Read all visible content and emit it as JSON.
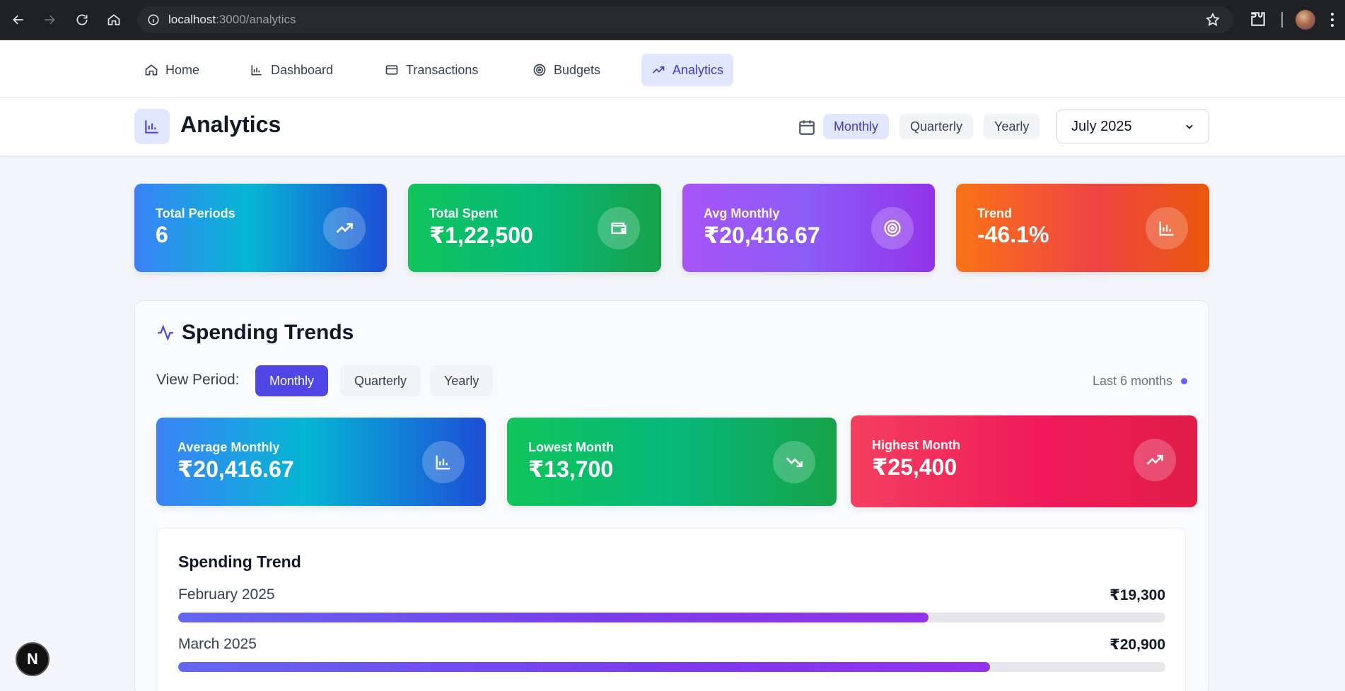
{
  "browser": {
    "url_host": "localhost",
    "url_path": ":3000/analytics"
  },
  "nav": {
    "items": [
      {
        "label": "Home",
        "icon": "home-icon"
      },
      {
        "label": "Dashboard",
        "icon": "bar-chart-icon"
      },
      {
        "label": "Transactions",
        "icon": "credit-card-icon"
      },
      {
        "label": "Budgets",
        "icon": "target-icon"
      },
      {
        "label": "Analytics",
        "icon": "trending-up-icon",
        "active": true
      }
    ]
  },
  "header": {
    "title": "Analytics",
    "period_buttons": [
      "Monthly",
      "Quarterly",
      "Yearly"
    ],
    "active_period": "Monthly",
    "selected_month": "July 2025"
  },
  "stats": [
    {
      "label": "Total Periods",
      "value": "6",
      "icon": "trending-up-icon",
      "gradient": "#3b82f6"
    },
    {
      "label": "Total Spent",
      "value": "₹1,22,500",
      "icon": "wallet-icon",
      "gradient": "#10c55a"
    },
    {
      "label": "Avg Monthly",
      "value": "₹20,416.67",
      "icon": "target-icon",
      "gradient": "#a855f7"
    },
    {
      "label": "Trend",
      "value": "-46.1%",
      "icon": "bar-chart-icon",
      "gradient": "#f97316"
    }
  ],
  "trends": {
    "title": "Spending Trends",
    "view_period_label": "View Period:",
    "view_buttons": [
      "Monthly",
      "Quarterly",
      "Yearly"
    ],
    "active_view": "Monthly",
    "range_text": "Last 6 months",
    "summary": [
      {
        "label": "Average Monthly",
        "value": "₹20,416.67",
        "icon": "bar-chart-icon"
      },
      {
        "label": "Lowest Month",
        "value": "₹13,700",
        "icon": "trending-down-icon"
      },
      {
        "label": "Highest Month",
        "value": "₹25,400",
        "icon": "trending-up-icon"
      }
    ],
    "chart_title": "Spending Trend",
    "rows": [
      {
        "month": "February 2025",
        "amount": "₹19,300",
        "fraction": 0.76
      },
      {
        "month": "March 2025",
        "amount": "₹20,900",
        "fraction": 0.822
      }
    ]
  },
  "dev_badge": "N"
}
